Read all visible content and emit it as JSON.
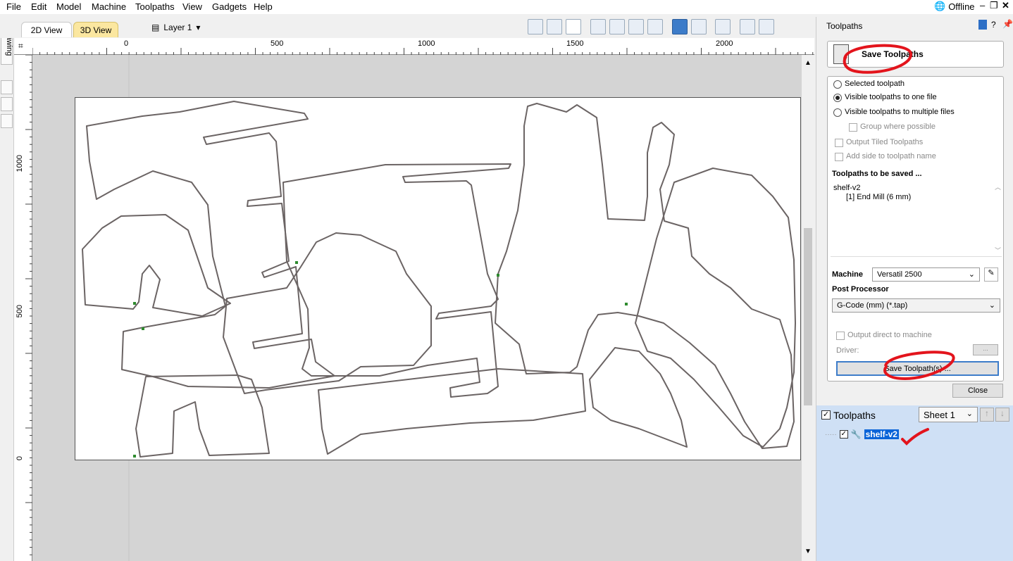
{
  "menu": [
    "File",
    "Edit",
    "Model",
    "Machine",
    "Toolpaths",
    "View",
    "Gadgets",
    "Help"
  ],
  "status": {
    "offline": "Offline"
  },
  "tabs": {
    "view2d": "2D View",
    "view3d": "3D View"
  },
  "layer": {
    "label": "Layer 1"
  },
  "left_strip": {
    "drawing": "Drawing"
  },
  "ruler": {
    "horizontal": [
      "0",
      "500",
      "1000",
      "1500",
      "2000"
    ],
    "vertical": [
      "1000",
      "500",
      "0"
    ]
  },
  "panel": {
    "title": "Toolpaths",
    "save_header": "Save Toolpaths",
    "options": {
      "selected": "Selected toolpath",
      "visible_one": "Visible toolpaths to one file",
      "visible_multiple": "Visible toolpaths to multiple files",
      "group_possible": "Group where possible",
      "output_tiled": "Output Tiled Toolpaths",
      "add_side": "Add side to toolpath name"
    },
    "to_be_saved_label": "Toolpaths to be saved ...",
    "saved_list": [
      "shelf-v2",
      "[1] End Mill (6 mm)"
    ],
    "machine_label": "Machine",
    "machine_value": "Versatil 2500",
    "post_label": "Post Processor",
    "post_value": "G-Code (mm) (*.tap)",
    "output_direct": "Output direct to machine",
    "driver_label": "Driver:",
    "driver_button": "...",
    "save_button": "Save Toolpath(s) ...",
    "close_button": "Close"
  },
  "toolpaths_list": {
    "title": "Toolpaths",
    "sheet": "Sheet 1",
    "item": "shelf-v2"
  },
  "colors": {
    "accent": "#3d7cc9",
    "annotation": "#e3141c",
    "selection": "#0a64d8"
  }
}
